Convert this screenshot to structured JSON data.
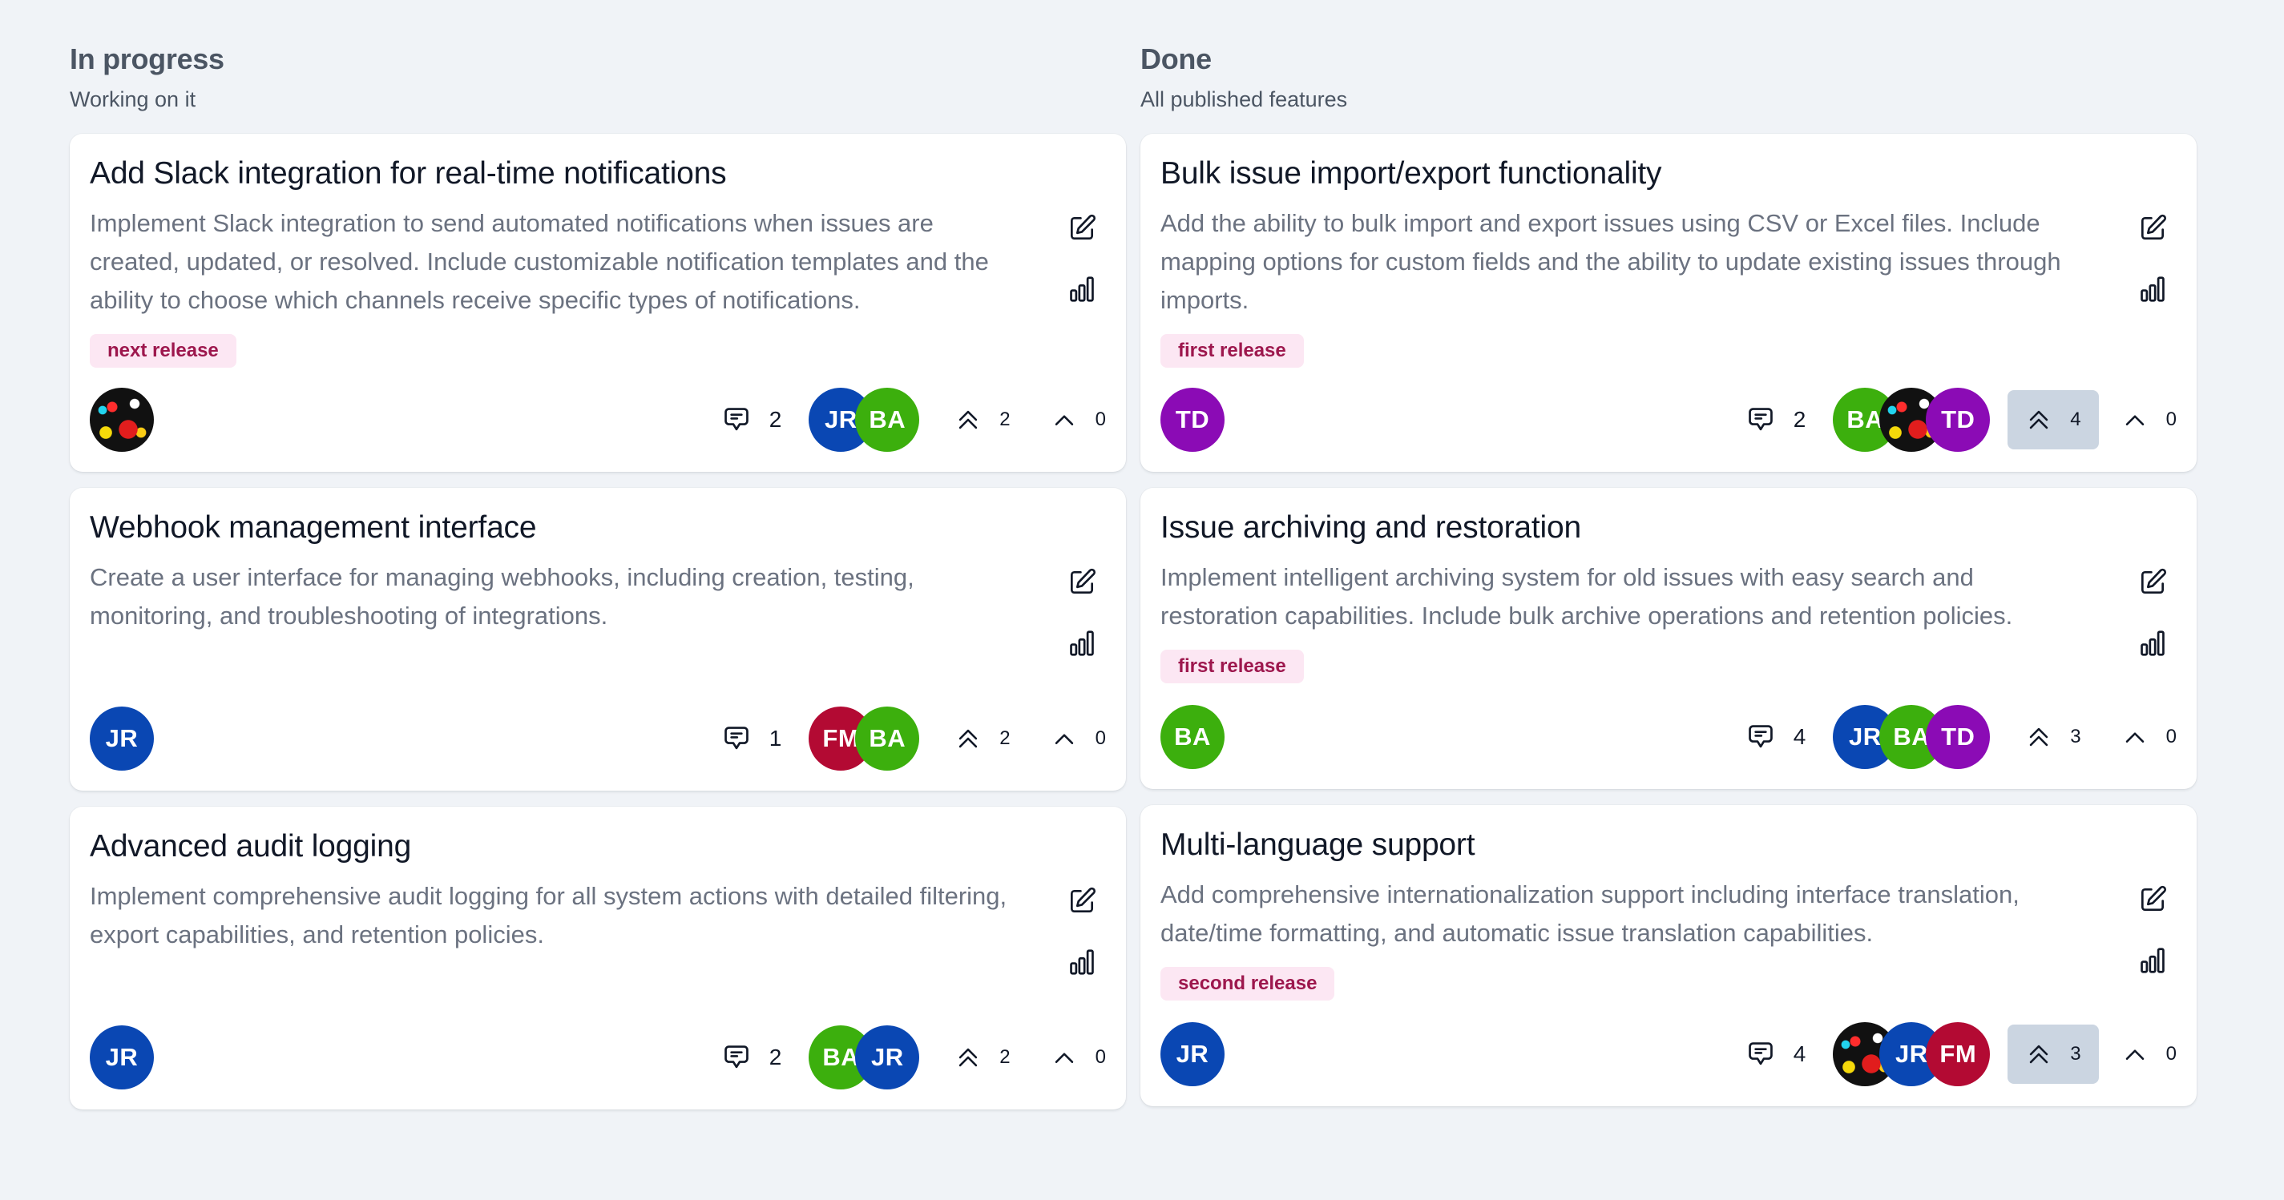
{
  "colors": {
    "background": "#f0f3f7",
    "tag_bg": "#fce7f3",
    "tag_text": "#9d174d",
    "active_vote_bg": "#cbd5e1"
  },
  "avatars": {
    "JR": {
      "initials": "JR",
      "color": "#0a47b3"
    },
    "BA": {
      "initials": "BA",
      "color": "#3caf0d"
    },
    "TD": {
      "initials": "TD",
      "color": "#8b0bb5"
    },
    "FM": {
      "initials": "FM",
      "color": "#b30a33"
    },
    "PHOTO": {
      "initials": "",
      "photo": true
    }
  },
  "columns": [
    {
      "title": "In progress",
      "subtitle": "Working on it",
      "cards": [
        {
          "title": "Add Slack integration for real-time notifications",
          "description": "Implement Slack integration to send automated notifications when issues are created, updated, or resolved. Include customizable notification templates and the ability to choose which channels receive specific types of notifications.",
          "tag": "next release",
          "owner": "PHOTO",
          "comments": "2",
          "participants": [
            "JR",
            "BA"
          ],
          "upvotes": "2",
          "upvote_active": false,
          "votes": "0"
        },
        {
          "title": "Webhook management interface",
          "description": "Create a user interface for managing webhooks, including creation, testing, monitoring, and troubleshooting of integrations.",
          "tag": null,
          "owner": "JR",
          "comments": "1",
          "participants": [
            "FM",
            "BA"
          ],
          "upvotes": "2",
          "upvote_active": false,
          "votes": "0"
        },
        {
          "title": "Advanced audit logging",
          "description": "Implement comprehensive audit logging for all system actions with detailed filtering, export capabilities, and retention policies.",
          "tag": null,
          "owner": "JR",
          "comments": "2",
          "participants": [
            "BA",
            "JR"
          ],
          "upvotes": "2",
          "upvote_active": false,
          "votes": "0"
        }
      ]
    },
    {
      "title": "Done",
      "subtitle": "All published features",
      "cards": [
        {
          "title": "Bulk issue import/export functionality",
          "description": "Add the ability to bulk import and export issues using CSV or Excel files. Include mapping options for custom fields and the ability to update existing issues through imports.",
          "tag": "first release",
          "owner": "TD",
          "comments": "2",
          "participants": [
            "BA",
            "PHOTO",
            "TD"
          ],
          "upvotes": "4",
          "upvote_active": true,
          "votes": "0"
        },
        {
          "title": "Issue archiving and restoration",
          "description": "Implement intelligent archiving system for old issues with easy search and restoration capabilities. Include bulk archive operations and retention policies.",
          "tag": "first release",
          "owner": "BA",
          "comments": "4",
          "participants": [
            "JR",
            "BA",
            "TD"
          ],
          "upvotes": "3",
          "upvote_active": false,
          "votes": "0"
        },
        {
          "title": "Multi-language support",
          "description": "Add comprehensive internationalization support including interface translation, date/time formatting, and automatic issue translation capabilities.",
          "tag": "second release",
          "owner": "JR",
          "comments": "4",
          "participants": [
            "PHOTO",
            "JR",
            "FM"
          ],
          "upvotes": "3",
          "upvote_active": true,
          "votes": "0"
        }
      ]
    }
  ],
  "icons": {
    "edit": "edit-icon",
    "stats": "bar-chart-icon",
    "comment": "comment-icon",
    "upvote": "double-chevron-up-icon",
    "vote": "chevron-up-icon"
  }
}
